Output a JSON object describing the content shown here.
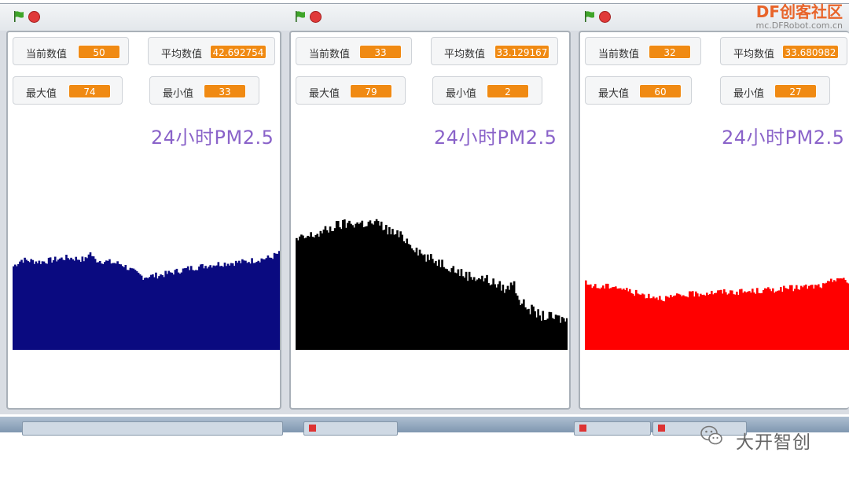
{
  "panels": [
    {
      "current_label": "当前数值",
      "current_value": "50",
      "avg_label": "平均数值",
      "avg_value": "42.692754",
      "max_label": "最大值",
      "max_value": "74",
      "min_label": "最小值",
      "min_value": "33",
      "title": "24小时PM2.5",
      "color": "#0a0a80"
    },
    {
      "current_label": "当前数值",
      "current_value": "33",
      "avg_label": "平均数值",
      "avg_value": "33.129167",
      "max_label": "最大值",
      "max_value": "79",
      "min_label": "最小值",
      "min_value": "2",
      "title": "24小时PM2.5",
      "color": "#000000"
    },
    {
      "current_label": "当前数值",
      "current_value": "32",
      "avg_label": "平均数值",
      "avg_value": "33.680982",
      "max_label": "最大值",
      "max_value": "60",
      "min_label": "最小值",
      "min_value": "27",
      "title": "24小时PM2.5",
      "color": "#ff0000"
    }
  ],
  "logo": {
    "line1": "DF创客社区",
    "line2": "mc.DFRobot.com.cn"
  },
  "watermark": "大开智创",
  "chart_data": [
    {
      "type": "area",
      "title": "24小时PM2.5",
      "keypoints": [
        [
          0,
          39
        ],
        [
          0.03,
          42
        ],
        [
          0.1,
          41
        ],
        [
          0.2,
          43
        ],
        [
          0.27,
          42
        ],
        [
          0.28,
          46
        ],
        [
          0.3,
          42
        ],
        [
          0.4,
          40
        ],
        [
          0.45,
          36
        ],
        [
          0.48,
          34
        ],
        [
          0.55,
          35
        ],
        [
          0.65,
          38
        ],
        [
          0.75,
          40
        ],
        [
          0.85,
          41
        ],
        [
          0.95,
          43
        ],
        [
          0.98,
          45
        ],
        [
          1,
          44
        ]
      ],
      "ylim": [
        0,
        110
      ]
    },
    {
      "type": "area",
      "title": "24小时PM2.5",
      "keypoints": [
        [
          0,
          51
        ],
        [
          0.05,
          53
        ],
        [
          0.1,
          55
        ],
        [
          0.15,
          58
        ],
        [
          0.2,
          59
        ],
        [
          0.3,
          59
        ],
        [
          0.35,
          55
        ],
        [
          0.4,
          52
        ],
        [
          0.48,
          43
        ],
        [
          0.55,
          40
        ],
        [
          0.62,
          35
        ],
        [
          0.7,
          33
        ],
        [
          0.78,
          28
        ],
        [
          0.8,
          32
        ],
        [
          0.83,
          22
        ],
        [
          0.9,
          16
        ],
        [
          1,
          14
        ]
      ],
      "ylim": [
        0,
        110
      ]
    },
    {
      "type": "area",
      "title": "24小时PM2.5",
      "keypoints": [
        [
          0,
          31
        ],
        [
          0.05,
          29
        ],
        [
          0.1,
          30
        ],
        [
          0.2,
          26
        ],
        [
          0.3,
          24
        ],
        [
          0.4,
          26
        ],
        [
          0.5,
          27
        ],
        [
          0.6,
          27
        ],
        [
          0.7,
          28
        ],
        [
          0.8,
          29
        ],
        [
          0.9,
          30
        ],
        [
          0.95,
          34
        ],
        [
          1,
          30
        ]
      ],
      "ylim": [
        0,
        110
      ]
    }
  ]
}
